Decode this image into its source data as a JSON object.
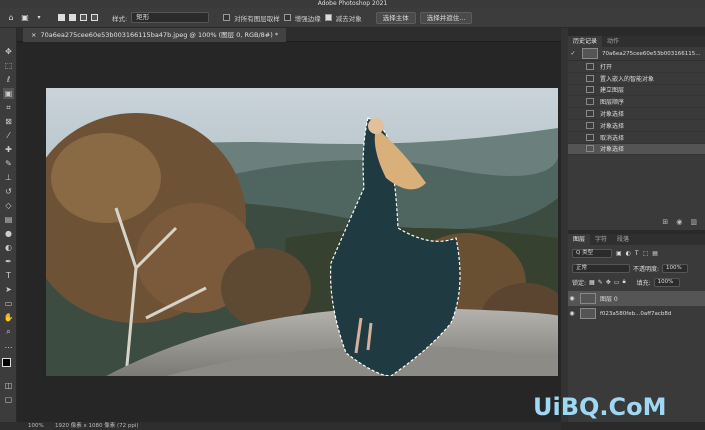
{
  "app": {
    "title": "Adobe Photoshop 2021"
  },
  "options_bar": {
    "style_label": "样式:",
    "style_value": "矩形",
    "sample_all_label": "对所有图层取样",
    "enhance_edge_label": "增强边缘",
    "subtract_label": "减去对象",
    "select_subject_button": "选择主体",
    "select_and_mask_button": "选择并遮住..."
  },
  "document_tab": {
    "label": "70a6ea275cee60e53b003166115ba47b.jpeg @ 100% (图层 0, RGB/8#) *"
  },
  "history_panel": {
    "tabs": [
      "历史记录",
      "动作"
    ],
    "snapshot_name": "70a6ea275cee60e53b003166115...",
    "items": [
      {
        "label": "打开",
        "selected": false
      },
      {
        "label": "置入嵌入的智能对象",
        "selected": false
      },
      {
        "label": "建立图层",
        "selected": false
      },
      {
        "label": "图层顺序",
        "selected": false
      },
      {
        "label": "对象选择",
        "selected": false
      },
      {
        "label": "对象选择",
        "selected": false
      },
      {
        "label": "取消选择",
        "selected": false
      },
      {
        "label": "对象选择",
        "selected": true
      }
    ]
  },
  "layers_panel": {
    "tabs": [
      "图层",
      "字符",
      "段落"
    ],
    "filter_kind": "Q 类型",
    "blend_mode": "正常",
    "opacity_label": "不透明度:",
    "opacity_value": "100%",
    "lock_label": "锁定:",
    "fill_label": "填充:",
    "fill_value": "100%",
    "layers": [
      {
        "name": "图层 0",
        "selected": true
      },
      {
        "name": "f023a580feb...0aff7acb8d",
        "selected": false
      }
    ]
  },
  "status_bar": {
    "zoom": "100%",
    "doc_info": "1920 像素 x 1080 像素 (72 ppi)"
  },
  "watermark": {
    "text": "UiBQ.CoM"
  }
}
